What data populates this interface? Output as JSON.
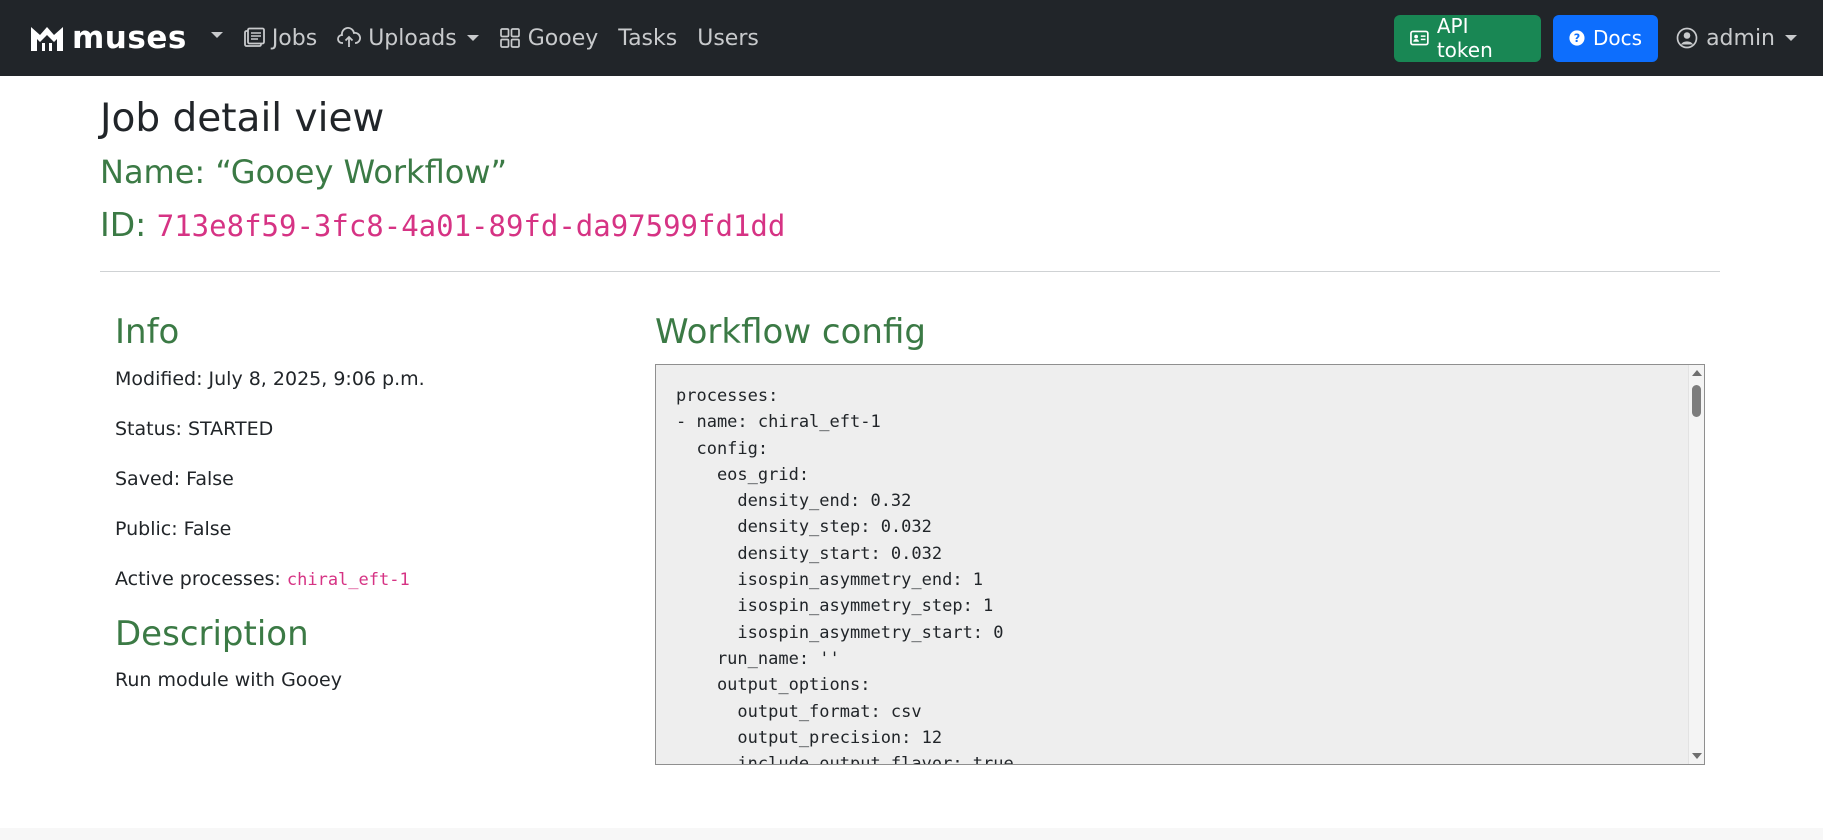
{
  "navbar": {
    "brand": "muses",
    "items": [
      {
        "label": "Jobs",
        "icon": "jobs-icon"
      },
      {
        "label": "Uploads",
        "icon": "cloud-upload-icon",
        "dropdown": true
      },
      {
        "label": "Gooey",
        "icon": "grid-icon"
      },
      {
        "label": "Tasks"
      },
      {
        "label": "Users"
      }
    ],
    "api_token_label": "API token",
    "docs_label": "Docs",
    "user_label": "admin"
  },
  "job": {
    "page_title": "Job detail view",
    "name_line": "Name: “Gooey Workflow”",
    "id_label": "ID:",
    "id_value": "713e8f59-3fc8-4a01-89fd-da97599fd1dd"
  },
  "info": {
    "title": "Info",
    "modified": "Modified: July 8, 2025, 9:06 p.m.",
    "status": "Status: STARTED",
    "saved": "Saved: False",
    "public": "Public: False",
    "active_label": "Active processes:",
    "active_value": "chiral_eft-1"
  },
  "description": {
    "title": "Description",
    "text": "Run module with Gooey"
  },
  "workflow": {
    "title": "Workflow config",
    "config": "processes:\n- name: chiral_eft-1\n  config:\n    eos_grid:\n      density_end: 0.32\n      density_step: 0.032\n      density_start: 0.032\n      isospin_asymmetry_end: 1\n      isospin_asymmetry_step: 1\n      isospin_asymmetry_start: 0\n    run_name: ''\n    output_options:\n      output_format: csv\n      output_precision: 12\n      include_output_flavor: true"
  },
  "colors": {
    "navbar_bg": "#212529",
    "heading_green": "#3b7a45",
    "code_pink": "#d63384",
    "api_button": "#198754",
    "docs_button": "#0d6efd"
  }
}
